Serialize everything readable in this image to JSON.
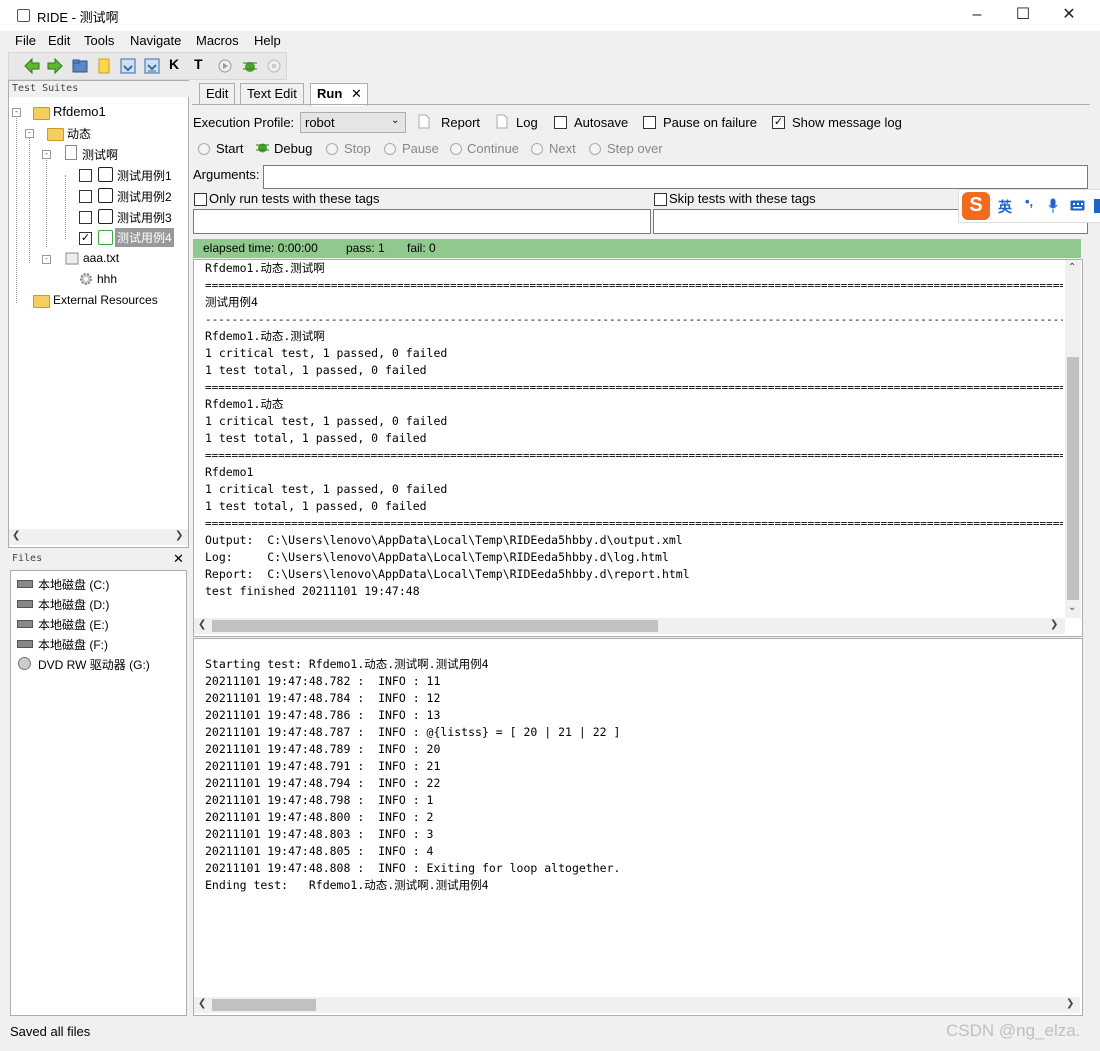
{
  "window": {
    "title": "RIDE - 测试啊"
  },
  "menu": [
    "File",
    "Edit",
    "Tools",
    "Navigate",
    "Macros",
    "Help"
  ],
  "toolbar": {
    "k_label": "K",
    "t_label": "T"
  },
  "test_suites": {
    "header": "Test Suites",
    "items": {
      "root": "Rfdemo1",
      "dir": "动态",
      "suite": "测试啊",
      "tc1": "测试用例1",
      "tc2": "测试用例2",
      "tc3": "测试用例3",
      "tc4": "测试用例4",
      "resource": "aaa.txt",
      "keyword": "hhh",
      "external": "External Resources"
    }
  },
  "files": {
    "header": "Files",
    "drives": [
      "本地磁盘 (C:)",
      "本地磁盘 (D:)",
      "本地磁盘 (E:)",
      "本地磁盘 (F:)",
      "DVD RW 驱动器 (G:)"
    ]
  },
  "tabs": {
    "edit": "Edit",
    "text_edit": "Text Edit",
    "run": "Run"
  },
  "run": {
    "profile_label": "Execution Profile:",
    "profile_value": "robot",
    "report": "Report",
    "log": "Log",
    "autosave": "Autosave",
    "pause_on_failure": "Pause on failure",
    "show_message_log": "Show message log",
    "controls": {
      "start": "Start",
      "debug": "Debug",
      "stop": "Stop",
      "pause": "Pause",
      "continue": "Continue",
      "next": "Next",
      "step_over": "Step over"
    },
    "arguments_label": "Arguments:",
    "only_run_tags": "Only run tests with these tags",
    "skip_tags": "Skip tests with these tags",
    "status": {
      "elapsed": "elapsed time: 0:00:00",
      "pass": "pass: 1",
      "fail": "fail: 0"
    }
  },
  "ime": {
    "lang": "英",
    "punct": "•,"
  },
  "output": {
    "lines": [
      "Rfdemo1.动态.测试啊",
      "==sep==",
      "测试用例4",
      "--sep--",
      "Rfdemo1.动态.测试啊",
      "1 critical test, 1 passed, 0 failed",
      "1 test total, 1 passed, 0 failed",
      "==sep==",
      "Rfdemo1.动态",
      "1 critical test, 1 passed, 0 failed",
      "1 test total, 1 passed, 0 failed",
      "==sep==",
      "Rfdemo1",
      "1 critical test, 1 passed, 0 failed",
      "1 test total, 1 passed, 0 failed",
      "==sep==",
      "Output:  C:\\Users\\lenovo\\AppData\\Local\\Temp\\RIDEeda5hbby.d\\output.xml",
      "Log:     C:\\Users\\lenovo\\AppData\\Local\\Temp\\RIDEeda5hbby.d\\log.html",
      "Report:  C:\\Users\\lenovo\\AppData\\Local\\Temp\\RIDEeda5hbby.d\\report.html",
      "",
      "test finished 20211101 19:47:48"
    ]
  },
  "message_log": {
    "lines": [
      "Starting test: Rfdemo1.动态.测试啊.测试用例4",
      "20211101 19:47:48.782 :  INFO : 11",
      "20211101 19:47:48.784 :  INFO : 12",
      "20211101 19:47:48.786 :  INFO : 13",
      "20211101 19:47:48.787 :  INFO : @{listss} = [ 20 | 21 | 22 ]",
      "20211101 19:47:48.789 :  INFO : 20",
      "20211101 19:47:48.791 :  INFO : 21",
      "20211101 19:47:48.794 :  INFO : 22",
      "20211101 19:47:48.798 :  INFO : 1",
      "20211101 19:47:48.800 :  INFO : 2",
      "20211101 19:47:48.803 :  INFO : 3",
      "20211101 19:47:48.805 :  INFO : 4",
      "20211101 19:47:48.808 :  INFO : Exiting for loop altogether.",
      "Ending test:   Rfdemo1.动态.测试啊.测试用例4"
    ]
  },
  "statusbar": {
    "text": "Saved all files"
  },
  "watermark": "CSDN @ng_elza."
}
